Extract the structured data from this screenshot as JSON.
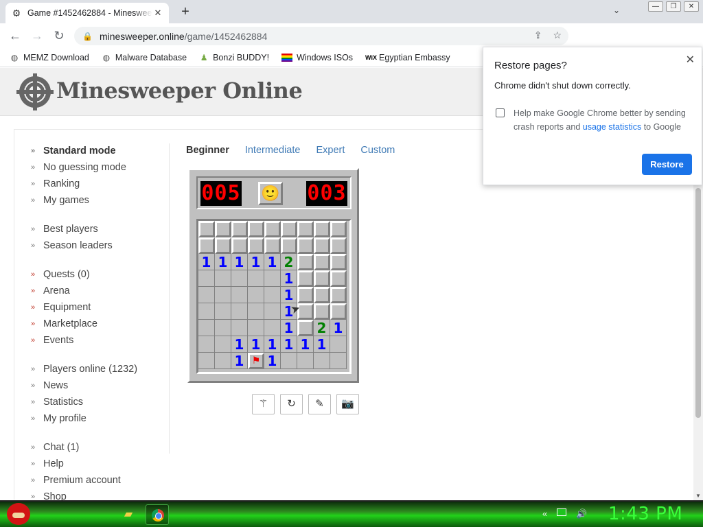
{
  "browser": {
    "tab_title": "Game #1452462884 - Minesweeper Online",
    "url_host": "minesweeper.online",
    "url_path": "/game/1452462884",
    "extension_badge": "2",
    "bookmarks": [
      {
        "label": "MEMZ Download",
        "icon": "globe-icon"
      },
      {
        "label": "Malware Database",
        "icon": "globe-icon"
      },
      {
        "label": "Bonzi BUDDY!",
        "icon": "bonzi-icon"
      },
      {
        "label": "Windows ISOs",
        "icon": "windows-flag-icon"
      },
      {
        "label": "Egyptian Embassy",
        "icon": "wix-icon"
      }
    ]
  },
  "site": {
    "title": "Minesweeper Online"
  },
  "sidebar": {
    "groups": [
      {
        "items": [
          {
            "label": "Standard mode",
            "bold": true,
            "red": false
          },
          {
            "label": "No guessing mode",
            "bold": false,
            "red": false
          },
          {
            "label": "Ranking",
            "bold": false,
            "red": false
          },
          {
            "label": "My games",
            "bold": false,
            "red": false
          }
        ]
      },
      {
        "items": [
          {
            "label": "Best players",
            "bold": false,
            "red": false
          },
          {
            "label": "Season leaders",
            "bold": false,
            "red": false
          }
        ]
      },
      {
        "items": [
          {
            "label": "Quests (0)",
            "bold": false,
            "red": true
          },
          {
            "label": "Arena",
            "bold": false,
            "red": true
          },
          {
            "label": "Equipment",
            "bold": false,
            "red": true
          },
          {
            "label": "Marketplace",
            "bold": false,
            "red": true
          },
          {
            "label": "Events",
            "bold": false,
            "red": true
          }
        ]
      },
      {
        "items": [
          {
            "label": "Players online (1232)",
            "bold": false,
            "red": false
          },
          {
            "label": "News",
            "bold": false,
            "red": false
          },
          {
            "label": "Statistics",
            "bold": false,
            "red": false
          },
          {
            "label": "My profile",
            "bold": false,
            "red": false
          }
        ]
      },
      {
        "items": [
          {
            "label": "Chat (1)",
            "bold": false,
            "red": false
          },
          {
            "label": "Help",
            "bold": false,
            "red": false
          },
          {
            "label": "Premium account",
            "bold": false,
            "red": false
          },
          {
            "label": "Shop",
            "bold": false,
            "red": false
          }
        ]
      }
    ]
  },
  "modes": [
    {
      "label": "Beginner",
      "active": true
    },
    {
      "label": "Intermediate",
      "active": false
    },
    {
      "label": "Expert",
      "active": false
    },
    {
      "label": "Custom",
      "active": false
    }
  ],
  "game": {
    "mines_left": "005",
    "timer": "003",
    "face": "🙂",
    "board": [
      [
        "C",
        "C",
        "C",
        "C",
        "C",
        "C",
        "C",
        "C",
        "C"
      ],
      [
        "C",
        "C",
        "C",
        "C",
        "C",
        "C",
        "C",
        "C",
        "C"
      ],
      [
        "1",
        "1",
        "1",
        "1",
        "1",
        "2",
        "C",
        "C",
        "C"
      ],
      [
        "0",
        "0",
        "0",
        "0",
        "0",
        "1",
        "C",
        "C",
        "C"
      ],
      [
        "0",
        "0",
        "0",
        "0",
        "0",
        "1",
        "C",
        "C",
        "C"
      ],
      [
        "0",
        "0",
        "0",
        "0",
        "0",
        "1",
        "C",
        "C",
        "C"
      ],
      [
        "0",
        "0",
        "0",
        "0",
        "0",
        "1",
        "C",
        "2",
        "1"
      ],
      [
        "0",
        "0",
        "1",
        "1",
        "1",
        "1",
        "1",
        "1",
        "0"
      ],
      [
        "0",
        "0",
        "1",
        "F",
        "1",
        "0",
        "0",
        "0",
        "0"
      ]
    ]
  },
  "tools": [
    {
      "name": "wand-icon",
      "glyph": "⚚"
    },
    {
      "name": "restart-icon",
      "glyph": "↻"
    },
    {
      "name": "edit-icon",
      "glyph": "✎"
    },
    {
      "name": "camera-icon",
      "glyph": "📷"
    }
  ],
  "popup": {
    "title": "Restore pages?",
    "message": "Chrome didn't shut down correctly.",
    "checkbox_text_before": "Help make Google Chrome better by sending crash reports and ",
    "checkbox_link": "usage statistics",
    "checkbox_text_after": " to Google",
    "restore_label": "Restore"
  },
  "taskbar": {
    "clock": "1:43 PM"
  }
}
